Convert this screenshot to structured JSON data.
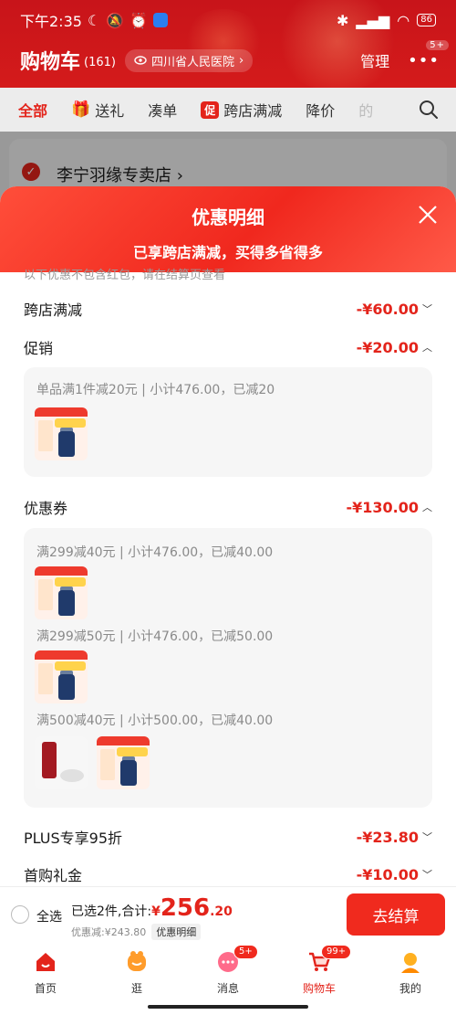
{
  "status": {
    "time": "下午2:35",
    "battery": "86"
  },
  "header": {
    "title": "购物车",
    "count": "(161)",
    "location": "四川省人民医院",
    "manage": "管理",
    "more_badge": "5+"
  },
  "tabs": [
    {
      "label": "全部",
      "active": true
    },
    {
      "label": "送礼",
      "icon": "gift-icon"
    },
    {
      "label": "凑单"
    },
    {
      "label": "跨店满减",
      "chip": "促"
    },
    {
      "label": "降价"
    },
    {
      "label": "的"
    }
  ],
  "store": {
    "name": "李宁羽缘专卖店"
  },
  "sheet": {
    "title": "优惠明细",
    "subtitle": "已享跨店满减，买得多省得多",
    "note": "以下优惠不包含红包，请在结算页查看",
    "rows": {
      "cross_store": {
        "label": "跨店满减",
        "amount": "-¥60.00"
      },
      "promo": {
        "label": "促销",
        "amount": "-¥20.00"
      },
      "coupon": {
        "label": "优惠券",
        "amount": "-¥130.00"
      },
      "plus": {
        "label": "PLUS专享95折",
        "amount": "-¥23.80"
      },
      "first_gift": {
        "label": "首购礼金",
        "amount": "-¥10.00"
      }
    },
    "promo_lines": [
      "单品满1件减20元 | 小计476.00，已减20"
    ],
    "coupon_lines": [
      "满299减40元 | 小计476.00，已减40.00",
      "满299减50元 | 小计476.00，已减50.00",
      "满500减40元 | 小计500.00，已减40.00"
    ]
  },
  "checkout": {
    "select_all": "全选",
    "selected": "已选2件,合计:",
    "yen": "¥",
    "total_int": "256",
    "total_dec": ".20",
    "discount": "优惠减:¥243.80",
    "detail_button": "优惠明细",
    "pay": "去结算"
  },
  "nav": [
    {
      "label": "首页",
      "icon": "home-icon"
    },
    {
      "label": "逛",
      "icon": "browse-icon"
    },
    {
      "label": "消息",
      "icon": "message-icon",
      "badge": "5+"
    },
    {
      "label": "购物车",
      "icon": "cart-icon",
      "badge": "99+",
      "active": true
    },
    {
      "label": "我的",
      "icon": "profile-icon"
    }
  ],
  "colors": {
    "brand_red": "#e3241b",
    "header_red": "#d41b1b"
  }
}
